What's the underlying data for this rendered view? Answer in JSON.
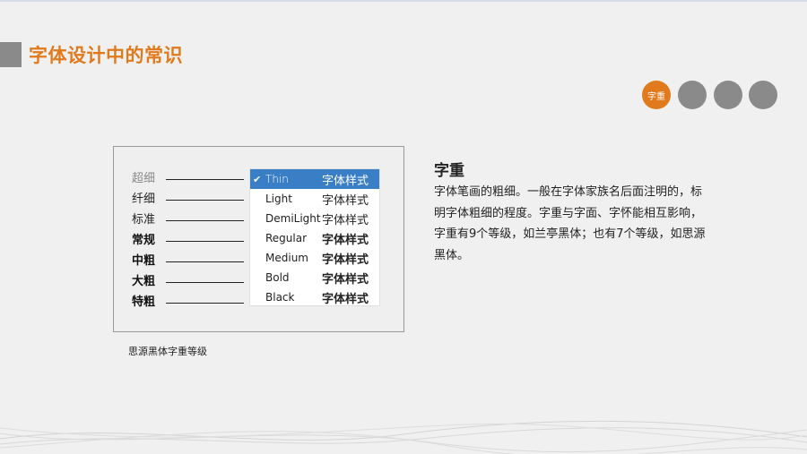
{
  "slide": {
    "title": "字体设计中的常识",
    "steps": [
      {
        "label": "字重",
        "active": true
      },
      {
        "label": "",
        "active": false
      },
      {
        "label": "",
        "active": false
      },
      {
        "label": "",
        "active": false
      }
    ]
  },
  "figure": {
    "weight_labels": [
      "超细",
      "纤细",
      "标准",
      "常规",
      "中粗",
      "大粗",
      "特粗"
    ],
    "weight_label_colors": [
      "#8a8a8a",
      "#222222",
      "#222222",
      "#111111",
      "#111111",
      "#111111",
      "#111111"
    ],
    "dropdown_items": [
      {
        "name": "Thin",
        "sample": "字体样式",
        "selected": true
      },
      {
        "name": "Light",
        "sample": "字体样式",
        "selected": false
      },
      {
        "name": "DemiLight",
        "sample": "字体样式",
        "selected": false
      },
      {
        "name": "Regular",
        "sample": "字体样式",
        "selected": false
      },
      {
        "name": "Medium",
        "sample": "字体样式",
        "selected": false
      },
      {
        "name": "Bold",
        "sample": "字体样式",
        "selected": false
      },
      {
        "name": "Black",
        "sample": "字体样式",
        "selected": false
      }
    ],
    "check_icon": "check-icon",
    "selected_color": "#3a7fc6",
    "caption": "思源黑体字重等级"
  },
  "section": {
    "heading": "字重",
    "body": "字体笔画的粗细。一般在字体家族名后面注明的，标明字体粗细的程度。字重与字面、字怀能相互影响，字重有9个等级，如兰亭黑体；也有7个等级，如思源黑体。"
  },
  "colors": {
    "accent": "#e07a1c",
    "gray": "#8a8a8a"
  }
}
